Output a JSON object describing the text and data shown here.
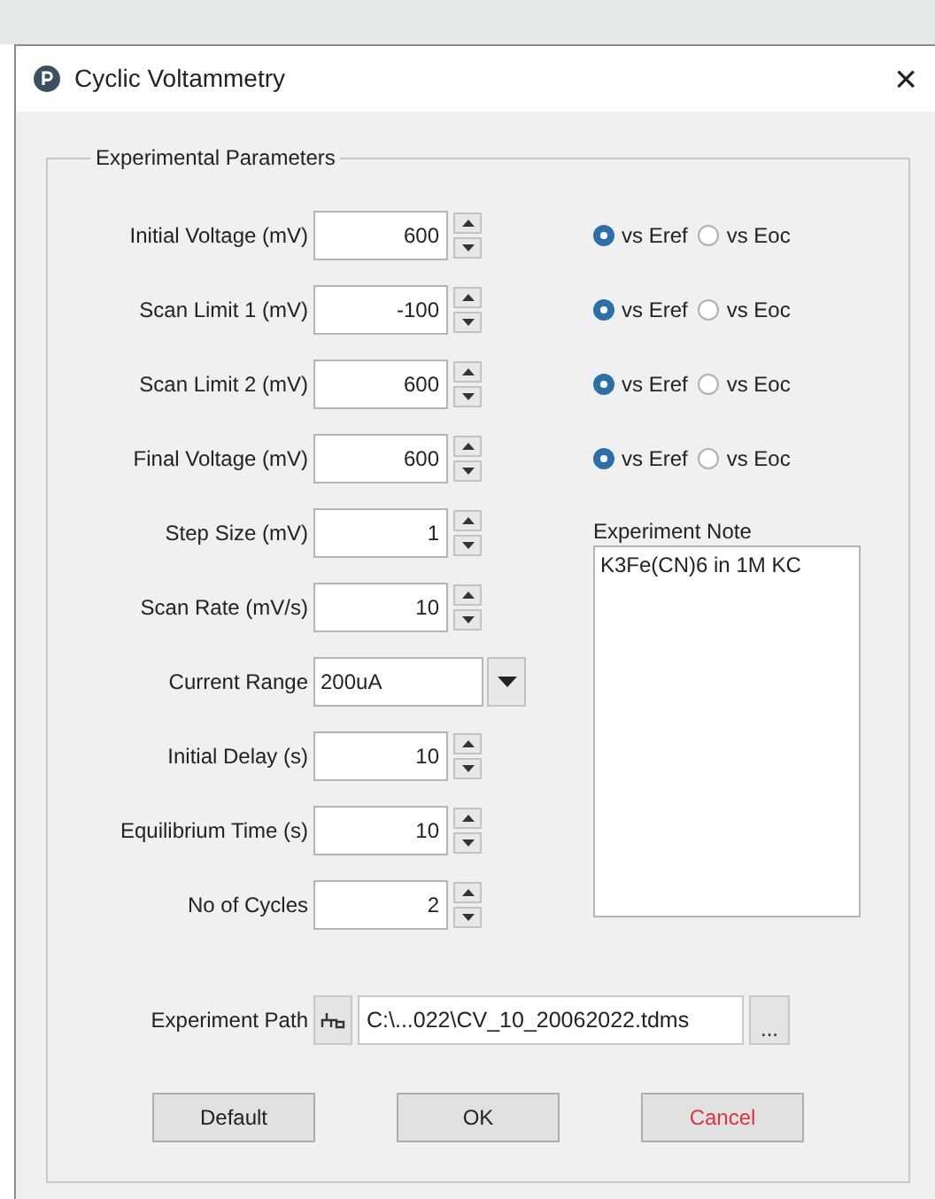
{
  "window": {
    "title": "Cyclic Voltammetry",
    "close": "×"
  },
  "group": {
    "title": "Experimental Parameters"
  },
  "parameters": [
    {
      "kind": "spin",
      "label": "Initial Voltage (mV)",
      "value": "600",
      "reference": [
        {
          "label": "vs Eref",
          "selected": true
        },
        {
          "label": "vs Eoc",
          "selected": false
        }
      ]
    },
    {
      "kind": "spin",
      "label": "Scan Limit 1 (mV)",
      "value": "-100",
      "reference": [
        {
          "label": "vs Eref",
          "selected": true
        },
        {
          "label": "vs Eoc",
          "selected": false
        }
      ]
    },
    {
      "kind": "spin",
      "label": "Scan Limit 2 (mV)",
      "value": "600",
      "reference": [
        {
          "label": "vs Eref",
          "selected": true
        },
        {
          "label": "vs Eoc",
          "selected": false
        }
      ]
    },
    {
      "kind": "spin",
      "label": "Final Voltage (mV)",
      "value": "600",
      "reference": [
        {
          "label": "vs Eref",
          "selected": true
        },
        {
          "label": "vs Eoc",
          "selected": false
        }
      ]
    },
    {
      "kind": "spin",
      "label": "Step Size (mV)",
      "value": "1"
    },
    {
      "kind": "spin",
      "label": "Scan Rate (mV/s)",
      "value": "10"
    },
    {
      "kind": "dropdown",
      "label": "Current Range",
      "value": "200uA"
    },
    {
      "kind": "spin",
      "label": "Initial Delay (s)",
      "value": "10"
    },
    {
      "kind": "spin",
      "label": "Equilibrium Time (s)",
      "value": "10"
    },
    {
      "kind": "spin",
      "label": "No of Cycles",
      "value": "2"
    }
  ],
  "note": {
    "label": "Experiment Note",
    "value": "K3Fe(CN)6 in 1M KC"
  },
  "path": {
    "label": "Experiment Path",
    "value": "C:\\...022\\CV_10_20062022.tdms",
    "browse": "..."
  },
  "buttons": [
    {
      "label": "Default",
      "kind": "normal"
    },
    {
      "label": "OK",
      "kind": "normal"
    },
    {
      "label": "Cancel",
      "kind": "cancel"
    }
  ]
}
